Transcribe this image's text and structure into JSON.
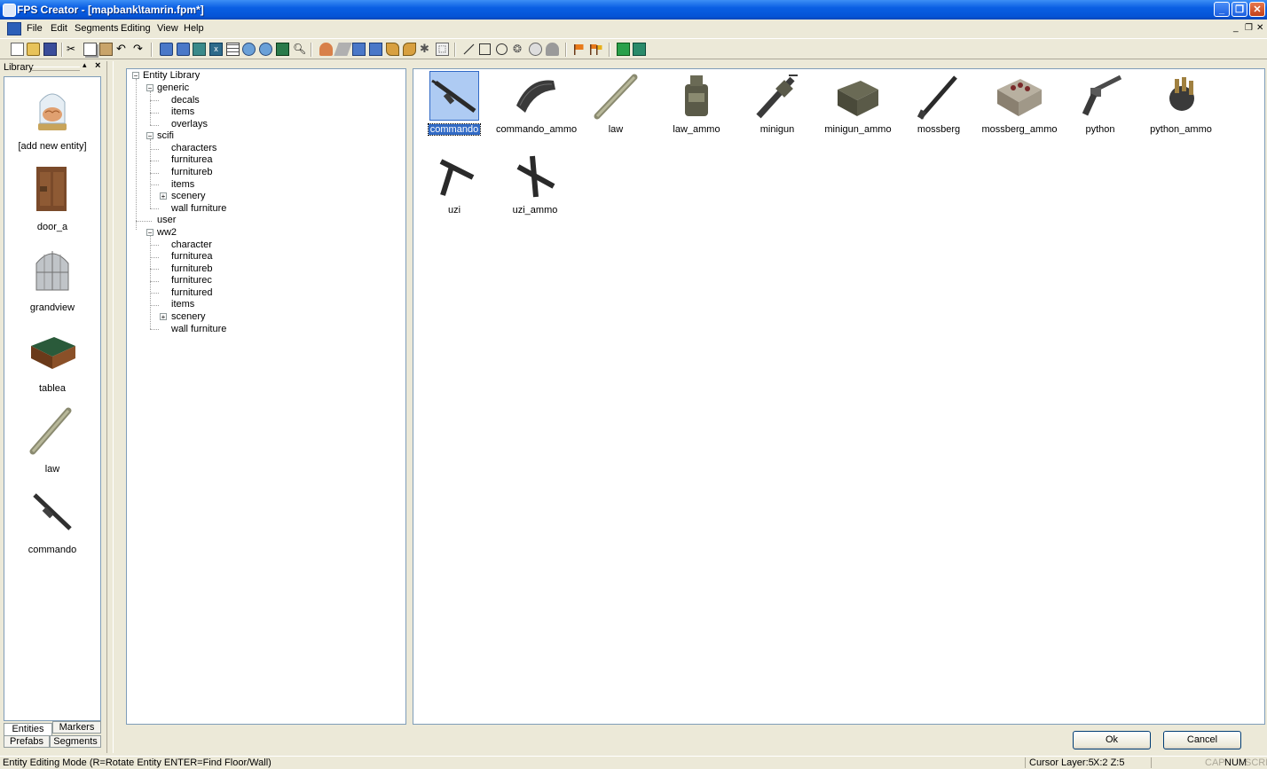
{
  "window": {
    "title": "FPS Creator - [mapbank\\tamrin.fpm*]",
    "controls": {
      "minimize": "_",
      "restore": "❐",
      "close": "✕"
    }
  },
  "menu": {
    "items": [
      "File",
      "Edit",
      "Segments",
      "Editing",
      "View",
      "Help"
    ],
    "mdi_controls": [
      "_",
      "❐",
      "✕"
    ]
  },
  "library": {
    "header": "Library",
    "items": [
      {
        "label": "[add new entity]",
        "icon": "brain-in-jar-icon"
      },
      {
        "label": "door_a",
        "icon": "door-icon"
      },
      {
        "label": "grandview",
        "icon": "window-icon"
      },
      {
        "label": "tablea",
        "icon": "table-icon"
      },
      {
        "label": "law",
        "icon": "rocket-launcher-icon"
      },
      {
        "label": "commando",
        "icon": "rifle-icon"
      }
    ],
    "tabs": {
      "entities": "Entities",
      "markers": "Markers",
      "prefabs": "Prefabs",
      "segments": "Segments"
    }
  },
  "tree": {
    "root": "Entity Library",
    "nodes": [
      {
        "label": "generic",
        "level": 1,
        "expander": "−"
      },
      {
        "label": "decals",
        "level": 2
      },
      {
        "label": "items",
        "level": 2
      },
      {
        "label": "overlays",
        "level": 2
      },
      {
        "label": "scifi",
        "level": 1,
        "expander": "−"
      },
      {
        "label": "characters",
        "level": 2
      },
      {
        "label": "furniturea",
        "level": 2
      },
      {
        "label": "furnitureb",
        "level": 2
      },
      {
        "label": "items",
        "level": 2
      },
      {
        "label": "scenery",
        "level": 2,
        "expander": "+"
      },
      {
        "label": "wall furniture",
        "level": 2
      },
      {
        "label": "user",
        "level": 1
      },
      {
        "label": "ww2",
        "level": 1,
        "expander": "−"
      },
      {
        "label": "character",
        "level": 2
      },
      {
        "label": "furniturea",
        "level": 2
      },
      {
        "label": "furnitureb",
        "level": 2
      },
      {
        "label": "furniturec",
        "level": 2
      },
      {
        "label": "furnitured",
        "level": 2
      },
      {
        "label": "items",
        "level": 2
      },
      {
        "label": "scenery",
        "level": 2,
        "expander": "+"
      },
      {
        "label": "wall furniture",
        "level": 2
      }
    ]
  },
  "entities": [
    {
      "label": "commando",
      "icon": "rifle-icon",
      "selected": true
    },
    {
      "label": "commando_ammo",
      "icon": "magazine-icon"
    },
    {
      "label": "law",
      "icon": "rocket-launcher-icon"
    },
    {
      "label": "law_ammo",
      "icon": "ammo-pack-icon"
    },
    {
      "label": "minigun",
      "icon": "minigun-icon"
    },
    {
      "label": "minigun_ammo",
      "icon": "ammo-box-icon"
    },
    {
      "label": "mossberg",
      "icon": "shotgun-icon"
    },
    {
      "label": "mossberg_ammo",
      "icon": "shell-box-icon"
    },
    {
      "label": "python",
      "icon": "revolver-icon"
    },
    {
      "label": "python_ammo",
      "icon": "bullets-icon"
    },
    {
      "label": "uzi",
      "icon": "smg-icon"
    },
    {
      "label": "uzi_ammo",
      "icon": "smg-magazine-icon"
    }
  ],
  "buttons": {
    "ok": "Ok",
    "cancel": "Cancel"
  },
  "status": {
    "mode": "Entity Editing Mode (R=Rotate Entity  ENTER=Find Floor/Wall)",
    "cursor_layer": "Cursor Layer:5",
    "coords": "X:2  Z:5",
    "cap": "CAP",
    "num": "NUM",
    "scrl": "SCRL"
  }
}
